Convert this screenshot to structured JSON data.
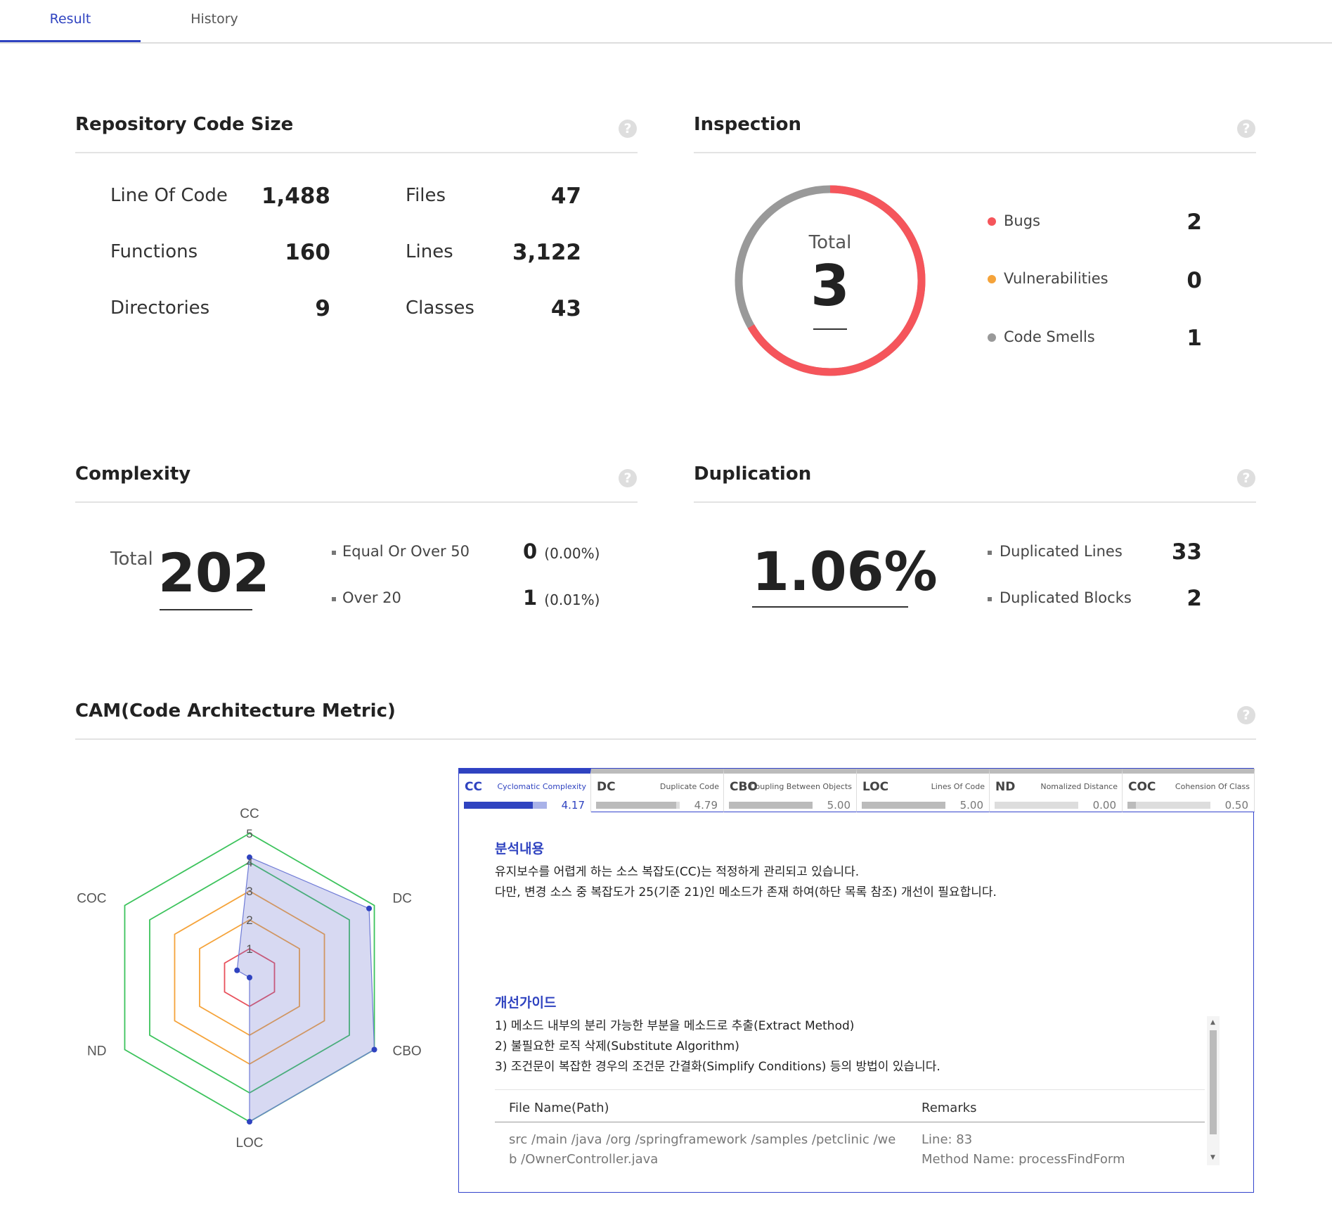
{
  "tabs": [
    {
      "label": "Result",
      "active": true
    },
    {
      "label": "History",
      "active": false
    }
  ],
  "help_icon": "question-circle-icon",
  "code_size": {
    "title": "Repository Code Size",
    "left": [
      {
        "label": "Line Of Code",
        "value": "1,488"
      },
      {
        "label": "Functions",
        "value": "160"
      },
      {
        "label": "Directories",
        "value": "9"
      }
    ],
    "right": [
      {
        "label": "Files",
        "value": "47"
      },
      {
        "label": "Lines",
        "value": "3,122"
      },
      {
        "label": "Classes",
        "value": "43"
      }
    ]
  },
  "inspection": {
    "title": "Inspection",
    "total_label": "Total",
    "total": "3",
    "items": [
      {
        "label": "Bugs",
        "value": "2",
        "color": "#f5555b"
      },
      {
        "label": "Vulnerabilities",
        "value": "0",
        "color": "#f5a33a"
      },
      {
        "label": "Code Smells",
        "value": "1",
        "color": "#999999"
      }
    ]
  },
  "complexity": {
    "title": "Complexity",
    "total_label": "Total",
    "total": "202",
    "items": [
      {
        "label": "Equal Or Over 50",
        "value": "0",
        "pct": "(0.00%)"
      },
      {
        "label": "Over 20",
        "value": "1",
        "pct": "(0.01%)"
      }
    ]
  },
  "duplication": {
    "title": "Duplication",
    "percent": "1.06%",
    "items": [
      {
        "label": "Duplicated Lines",
        "value": "33"
      },
      {
        "label": "Duplicated Blocks",
        "value": "2"
      }
    ]
  },
  "cam": {
    "title": "CAM(Code Architecture Metric)",
    "radar": {
      "axes": [
        "CC",
        "DC",
        "CBO",
        "LOC",
        "ND",
        "COC"
      ],
      "ticks": [
        "1",
        "2",
        "3",
        "4",
        "5"
      ],
      "values": [
        4.17,
        4.79,
        5.0,
        5.0,
        0.0,
        0.5
      ]
    },
    "metrics": [
      {
        "name": "CC",
        "desc": "Cyclomatic Complexity",
        "value": "4.17",
        "ratio": 0.834,
        "active": true
      },
      {
        "name": "DC",
        "desc": "Duplicate Code",
        "value": "4.79",
        "ratio": 0.958,
        "active": false
      },
      {
        "name": "CBO",
        "desc": "Coupling Between Objects",
        "value": "5.00",
        "ratio": 1.0,
        "active": false
      },
      {
        "name": "LOC",
        "desc": "Lines Of Code",
        "value": "5.00",
        "ratio": 1.0,
        "active": false
      },
      {
        "name": "ND",
        "desc": "Nomalized Distance",
        "value": "0.00",
        "ratio": 0.0,
        "active": false
      },
      {
        "name": "COC",
        "desc": "Cohension Of Class",
        "value": "0.50",
        "ratio": 0.1,
        "active": false
      }
    ],
    "analysis_title": "분석내용",
    "analysis_lines": [
      "유지보수를 어렵게 하는 소스 복잡도(CC)는 적정하게 관리되고 있습니다.",
      "다만, 변경 소스 중 복잡도가 25(기준 21)인 메소드가 존재 하여(하단 목록 참조) 개선이 필요합니다."
    ],
    "guide_title": "개선가이드",
    "guide_lines": [
      "1) 메소드 내부의 분리 가능한 부분을 메소드로 추출(Extract Method)",
      "2) 불필요한 로직 삭제(Substitute Algorithm)",
      "3) 조건문이 복잡한 경우의 조건문 간결화(Simplify Conditions) 등의 방법이 있습니다."
    ],
    "table": {
      "headers": [
        "File Name(Path)",
        "Remarks"
      ],
      "rows": [
        {
          "path_line1": "src /main /java /org /springframework /samples /petclinic /we",
          "path_line2": "b /OwnerController.java",
          "remark_line1": "Line: 83",
          "remark_line2": "Method Name: processFindForm"
        }
      ]
    }
  }
}
